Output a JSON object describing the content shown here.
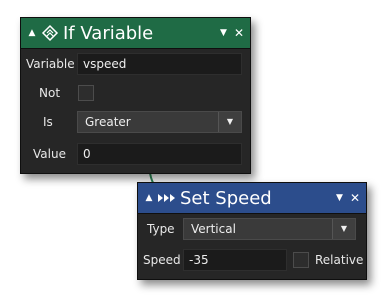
{
  "if_variable": {
    "title": "If Variable",
    "collapse_icon": "triangle-collapse-icon",
    "action_icon": "variable-if-icon",
    "fields": {
      "variable_label": "Variable",
      "variable_value": "vspeed",
      "not_label": "Not",
      "not_checked": false,
      "is_label": "Is",
      "is_value": "Greater",
      "value_label": "Value",
      "value_value": "0"
    }
  },
  "set_speed": {
    "title": "Set Speed",
    "collapse_icon": "triangle-collapse-icon",
    "action_icon": "speed-arrows-icon",
    "fields": {
      "type_label": "Type",
      "type_value": "Vertical",
      "speed_label": "Speed",
      "speed_value": "-35",
      "relative_label": "Relative",
      "relative_checked": false
    }
  },
  "colors": {
    "if_header": "#1f6b45",
    "speed_header": "#2c4d8c",
    "node_body": "#262626",
    "connector": "#2f8a57"
  }
}
